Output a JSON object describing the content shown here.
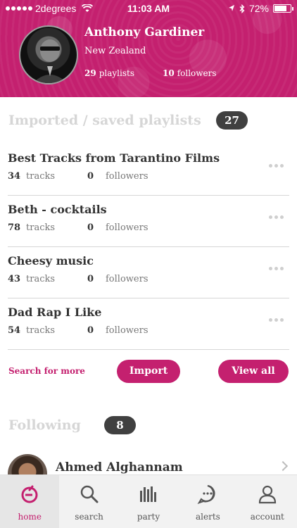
{
  "status_bar": {
    "carrier": "2degrees",
    "time": "11:03 AM",
    "battery": "72%"
  },
  "profile": {
    "name": "Anthony Gardiner",
    "location": "New Zealand",
    "playlists_count": "29",
    "playlists_label": "playlists",
    "followers_count": "10",
    "followers_label": "followers"
  },
  "imported_section": {
    "title": "Imported / saved playlists",
    "count": "27"
  },
  "playlists": [
    {
      "title": "Best Tracks from Tarantino Films",
      "tracks": "34",
      "tracks_label": "tracks",
      "followers": "0",
      "followers_label": "followers"
    },
    {
      "title": "Beth - cocktails",
      "tracks": "78",
      "tracks_label": "tracks",
      "followers": "0",
      "followers_label": "followers"
    },
    {
      "title": "Cheesy music",
      "tracks": "43",
      "tracks_label": "tracks",
      "followers": "0",
      "followers_label": "followers"
    },
    {
      "title": "Dad Rap I Like",
      "tracks": "54",
      "tracks_label": "tracks",
      "followers": "0",
      "followers_label": "followers"
    }
  ],
  "actions": {
    "search_more": "Search for more",
    "import": "Import",
    "view_all": "View all"
  },
  "following_section": {
    "title": "Following",
    "count": "8"
  },
  "following": [
    {
      "name": "Ahmed Alghannam"
    }
  ],
  "tabs": [
    {
      "label": "home",
      "icon": "home-icon",
      "active": true
    },
    {
      "label": "search",
      "icon": "search-icon"
    },
    {
      "label": "party",
      "icon": "party-icon"
    },
    {
      "label": "alerts",
      "icon": "alerts-icon"
    },
    {
      "label": "account",
      "icon": "account-icon"
    }
  ],
  "colors": {
    "accent": "#c4206f",
    "badge": "#404040",
    "divider": "#d6d6d6"
  }
}
